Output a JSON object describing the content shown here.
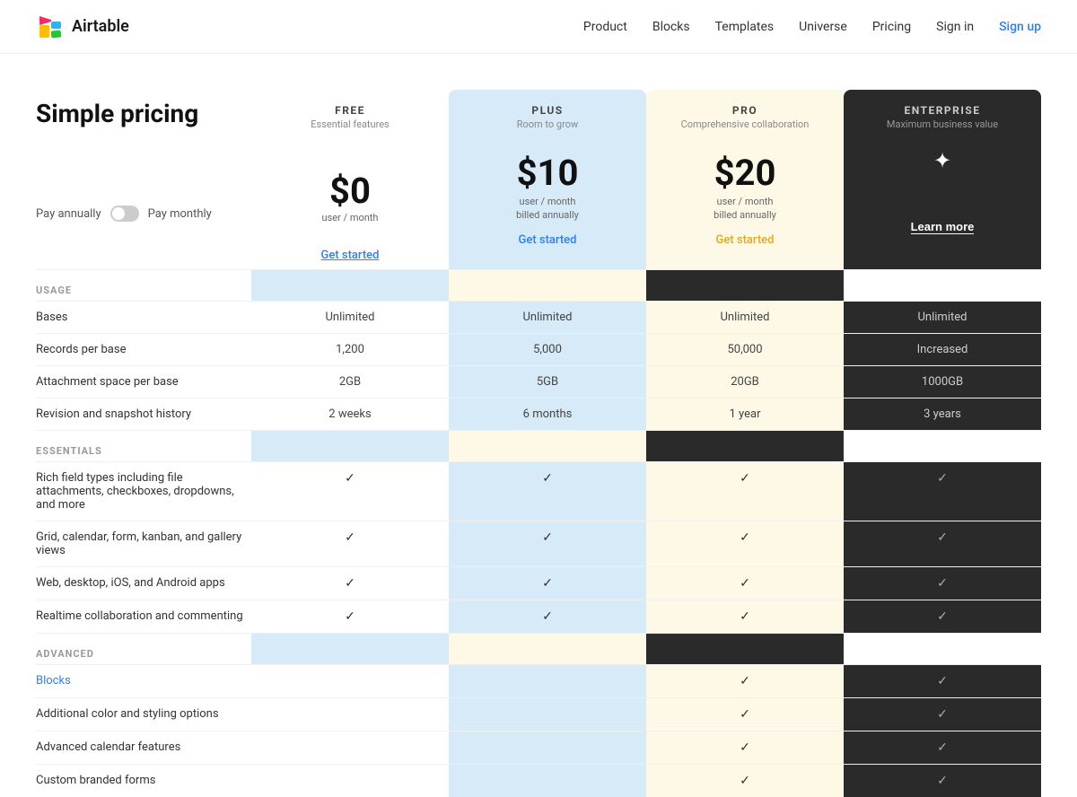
{
  "nav": {
    "logo_text": "Airtable",
    "links": [
      {
        "label": "Product",
        "id": "product"
      },
      {
        "label": "Blocks",
        "id": "blocks"
      },
      {
        "label": "Templates",
        "id": "templates"
      },
      {
        "label": "Universe",
        "id": "universe"
      },
      {
        "label": "Pricing",
        "id": "pricing"
      },
      {
        "label": "Sign in",
        "id": "signin"
      },
      {
        "label": "Sign up",
        "id": "signup"
      }
    ]
  },
  "pricing": {
    "title": "Simple pricing",
    "toggle": {
      "left": "Pay annually",
      "right": "Pay monthly"
    },
    "plans": {
      "free": {
        "name": "FREE",
        "tagline": "Essential features",
        "price": "$0",
        "price_sub": "user / month",
        "cta": "Get started"
      },
      "plus": {
        "name": "PLUS",
        "tagline": "Room to grow",
        "price": "$10",
        "price_sub1": "user / month",
        "price_sub2": "billed annually",
        "cta": "Get started"
      },
      "pro": {
        "name": "PRO",
        "tagline": "Comprehensive collaboration",
        "price": "$20",
        "price_sub1": "user / month",
        "price_sub2": "billed annually",
        "cta": "Get started"
      },
      "enterprise": {
        "name": "ENTERPRISE",
        "tagline": "Maximum business value",
        "sparkle": "✦",
        "cta": "Learn more"
      }
    },
    "sections": {
      "usage": {
        "label": "USAGE",
        "rows": [
          {
            "label": "Bases",
            "free": "Unlimited",
            "plus": "Unlimited",
            "pro": "Unlimited",
            "enterprise": "Unlimited"
          },
          {
            "label": "Records per base",
            "free": "1,200",
            "plus": "5,000",
            "pro": "50,000",
            "enterprise": "Increased"
          },
          {
            "label": "Attachment space per base",
            "free": "2GB",
            "plus": "5GB",
            "pro": "20GB",
            "enterprise": "1000GB"
          },
          {
            "label": "Revision and snapshot history",
            "free": "2 weeks",
            "plus": "6 months",
            "pro": "1 year",
            "enterprise": "3 years"
          }
        ]
      },
      "essentials": {
        "label": "ESSENTIALS",
        "rows": [
          {
            "label": "Rich field types including file attachments, checkboxes, dropdowns, and more",
            "free": "✓",
            "plus": "✓",
            "pro": "✓",
            "enterprise": "✓"
          },
          {
            "label": "Grid, calendar, form, kanban, and gallery views",
            "free": "✓",
            "plus": "✓",
            "pro": "✓",
            "enterprise": "✓"
          },
          {
            "label": "Web, desktop, iOS, and Android apps",
            "free": "✓",
            "plus": "✓",
            "pro": "✓",
            "enterprise": "✓"
          },
          {
            "label": "Realtime collaboration and commenting",
            "free": "✓",
            "plus": "✓",
            "pro": "✓",
            "enterprise": "✓"
          }
        ]
      },
      "advanced": {
        "label": "ADVANCED",
        "rows": [
          {
            "label": "Blocks",
            "is_link": true,
            "free": "",
            "plus": "",
            "pro": "✓",
            "enterprise": "✓"
          },
          {
            "label": "Additional color and styling options",
            "free": "",
            "plus": "",
            "pro": "✓",
            "enterprise": "✓"
          },
          {
            "label": "Advanced calendar features",
            "free": "",
            "plus": "",
            "pro": "✓",
            "enterprise": "✓"
          },
          {
            "label": "Custom branded forms",
            "free": "",
            "plus": "",
            "pro": "✓",
            "enterprise": "✓"
          }
        ]
      }
    }
  }
}
